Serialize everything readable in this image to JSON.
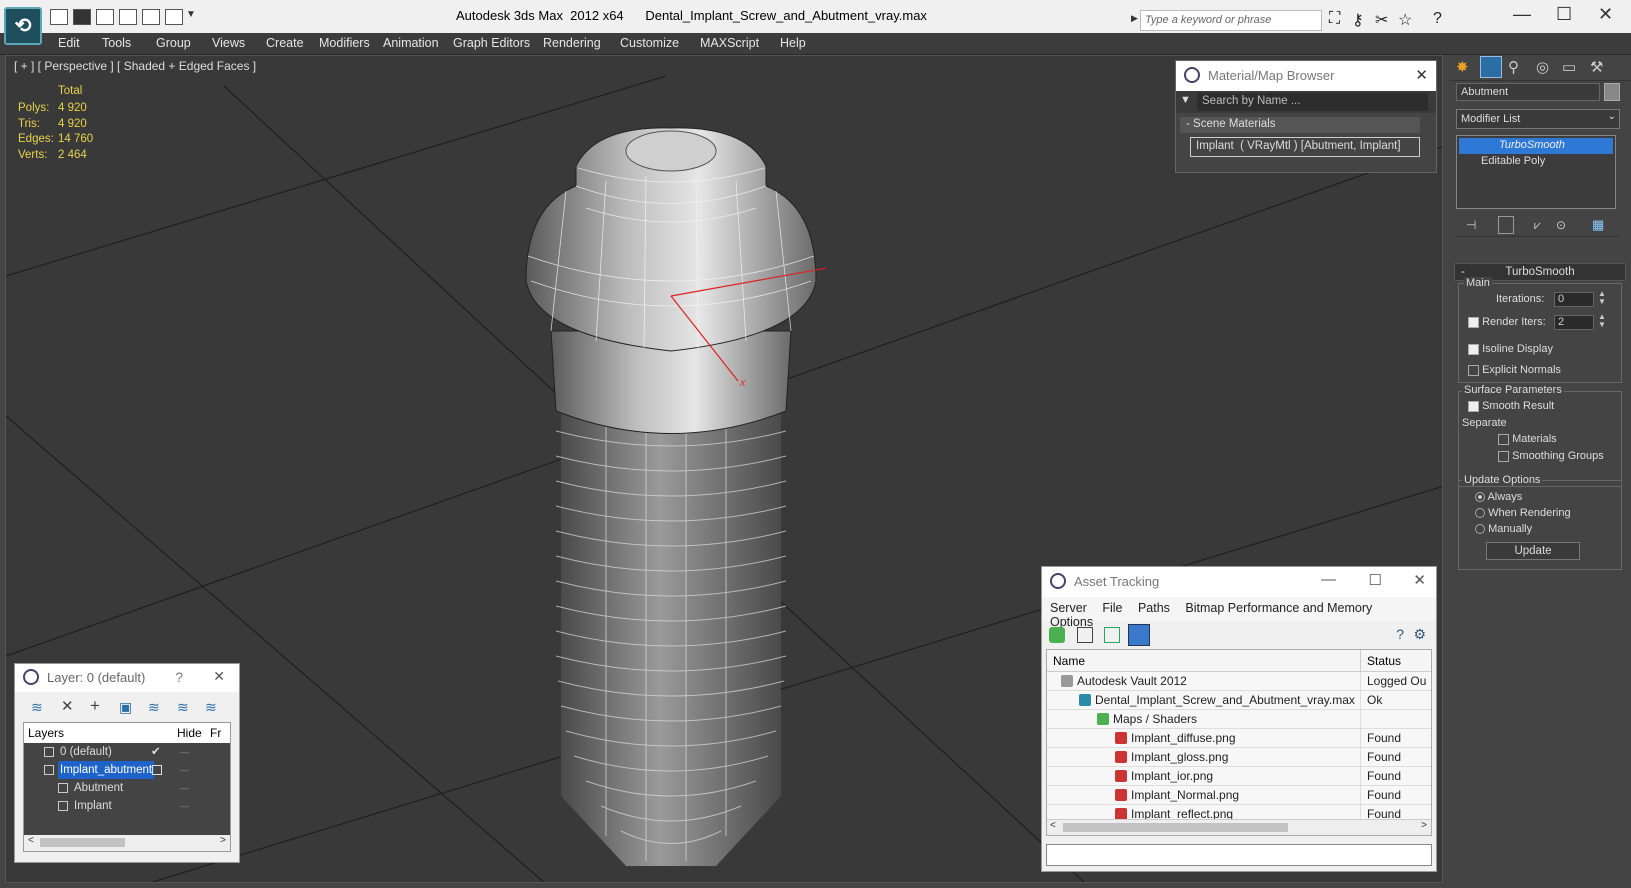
{
  "titlebar": {
    "app": "Autodesk 3ds Max  2012 x64",
    "file": "Dental_Implant_Screw_and_Abutment_vray.max",
    "search_placeholder": "Type a keyword or phrase"
  },
  "menu": [
    "Edit",
    "Tools",
    "Group",
    "Views",
    "Create",
    "Modifiers",
    "Animation",
    "Graph Editors",
    "Rendering",
    "Customize",
    "MAXScript",
    "Help"
  ],
  "viewport": {
    "label": "[ + ] [ Perspective ] [ Shaded + Edged Faces ]",
    "stats_header": "Total",
    "stats": [
      {
        "k": "Polys:",
        "v": "4 920"
      },
      {
        "k": "Tris:",
        "v": "4 920"
      },
      {
        "k": "Edges:",
        "v": "14 760"
      },
      {
        "k": "Verts:",
        "v": "2 464"
      }
    ],
    "axis_y": "y",
    "axis_x": "x"
  },
  "material_browser": {
    "title": "Material/Map Browser",
    "search_placeholder": "Search by Name ...",
    "section": "- Scene Materials",
    "item": "Implant  ( VRayMtl ) [Abutment, Implant]"
  },
  "asset_tracking": {
    "title": "Asset Tracking",
    "menu": [
      "Server",
      "File",
      "Paths",
      "Bitmap Performance and Memory",
      "Options"
    ],
    "col_name": "Name",
    "col_status": "Status",
    "rows": [
      {
        "name": "Autodesk Vault 2012",
        "status": "Logged Ou",
        "indent": 1
      },
      {
        "name": "Dental_Implant_Screw_and_Abutment_vray.max",
        "status": "Ok",
        "indent": 2
      },
      {
        "name": "Maps / Shaders",
        "status": "",
        "indent": 3
      },
      {
        "name": "Implant_diffuse.png",
        "status": "Found",
        "indent": 4
      },
      {
        "name": "Implant_gloss.png",
        "status": "Found",
        "indent": 4
      },
      {
        "name": "Implant_ior.png",
        "status": "Found",
        "indent": 4
      },
      {
        "name": "Implant_Normal.png",
        "status": "Found",
        "indent": 4
      },
      {
        "name": "Implant_reflect.png",
        "status": "Found",
        "indent": 4
      }
    ]
  },
  "layer_dialog": {
    "title": "Layer: 0 (default)",
    "help": "?",
    "col_layers": "Layers",
    "col_hide": "Hide",
    "col_fr": "Fr",
    "rows": [
      {
        "name": "0 (default)",
        "indent": 1
      },
      {
        "name": "Implant_abutment",
        "indent": 1,
        "selected": true
      },
      {
        "name": "Abutment",
        "indent": 2
      },
      {
        "name": "Implant",
        "indent": 2
      }
    ]
  },
  "command_panel": {
    "object_name": "Abutment",
    "modifier_list": "Modifier List",
    "stack": [
      "TurboSmooth",
      "Editable Poly"
    ],
    "rollout": "TurboSmooth",
    "main": "Main",
    "iterations_label": "Iterations:",
    "iterations": "0",
    "render_iters_label": "Render Iters:",
    "render_iters": "2",
    "isoline": "Isoline Display",
    "explicit": "Explicit Normals",
    "surface": "Surface Parameters",
    "smooth": "Smooth Result",
    "separate": "Separate",
    "materials": "Materials",
    "smoothing": "Smoothing Groups",
    "update_options": "Update Options",
    "always": "Always",
    "when_rendering": "When Rendering",
    "manually": "Manually",
    "update": "Update"
  },
  "colors": {
    "viewport_bg": "#393939",
    "stats": "#e8d34b",
    "selection": "#1e63c9"
  }
}
